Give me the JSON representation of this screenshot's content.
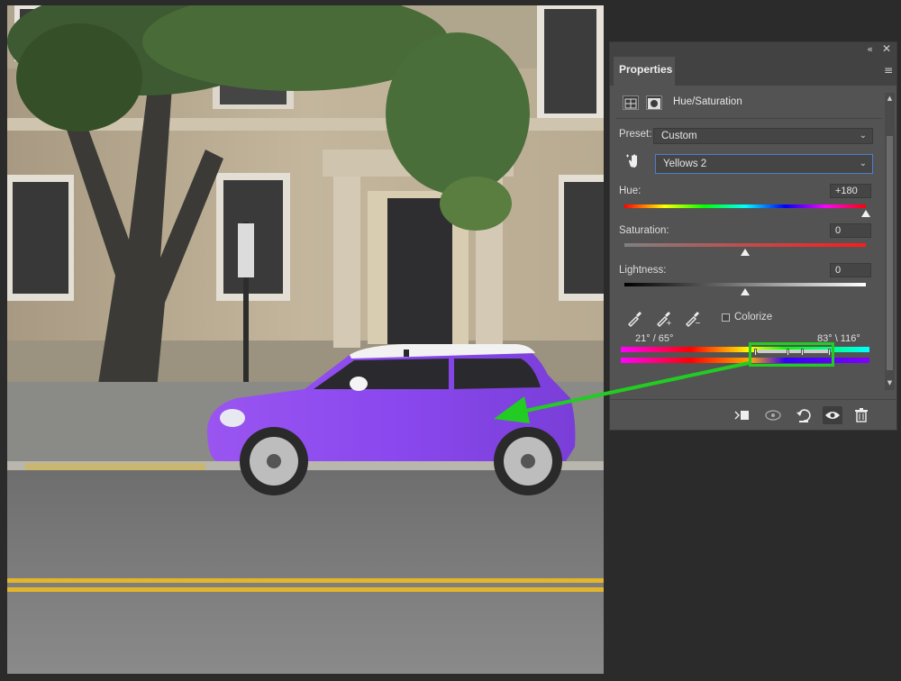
{
  "panel": {
    "tab_label": "Properties",
    "collapse_glyph": "«",
    "close_glyph": "✕",
    "menu_glyph": "≡",
    "adjustment_title": "Hue/Saturation",
    "preset": {
      "label": "Preset:",
      "value": "Custom"
    },
    "range_select": {
      "value": "Yellows 2"
    },
    "hue": {
      "label": "Hue:",
      "value": "+180",
      "level": 1.0
    },
    "saturation": {
      "label": "Saturation:",
      "value": "0",
      "level": 0.5
    },
    "lightness": {
      "label": "Lightness:",
      "value": "0",
      "level": 0.5
    },
    "colorize_label": "Colorize",
    "colorize_checked": false,
    "range_left": "21° / 65°",
    "range_right": "83° \\ 116°"
  },
  "colors": {
    "panel_bg": "#535353",
    "annotation": "#22cc22",
    "car_body": "#8a4ef0"
  },
  "icons": [
    "hand-target-icon",
    "eyedropper-icon",
    "eyedropper-add-icon",
    "eyedropper-subtract-icon",
    "clip-to-layer-icon",
    "view-previous-icon",
    "reset-icon",
    "visibility-icon",
    "trash-icon"
  ]
}
